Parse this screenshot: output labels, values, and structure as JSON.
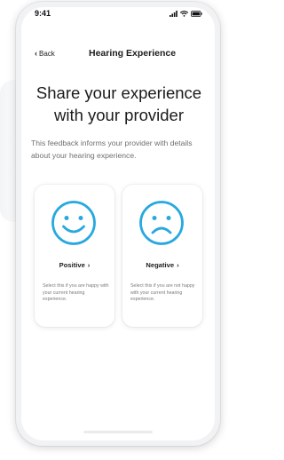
{
  "status_bar": {
    "time": "9:41",
    "icons": [
      "signal-icon",
      "wifi-icon",
      "battery-icon"
    ]
  },
  "nav": {
    "back_label": "Back",
    "title": "Hearing Experience"
  },
  "headline": {
    "line1": "Share your experience",
    "line2": "with your provider"
  },
  "subtext": "This feedback informs your provider with details about your hearing experience.",
  "cards": {
    "positive": {
      "label": "Positive",
      "icon": "happy-face-icon",
      "description": "Select this if you are happy with your current hearing experience."
    },
    "negative": {
      "label": "Negative",
      "icon": "sad-face-icon",
      "description": "Select this if you are not happy with your current hearing experience."
    }
  },
  "colors": {
    "accent": "#27a8e0",
    "text": "#1b1b1b",
    "muted": "#6f6f6f"
  }
}
